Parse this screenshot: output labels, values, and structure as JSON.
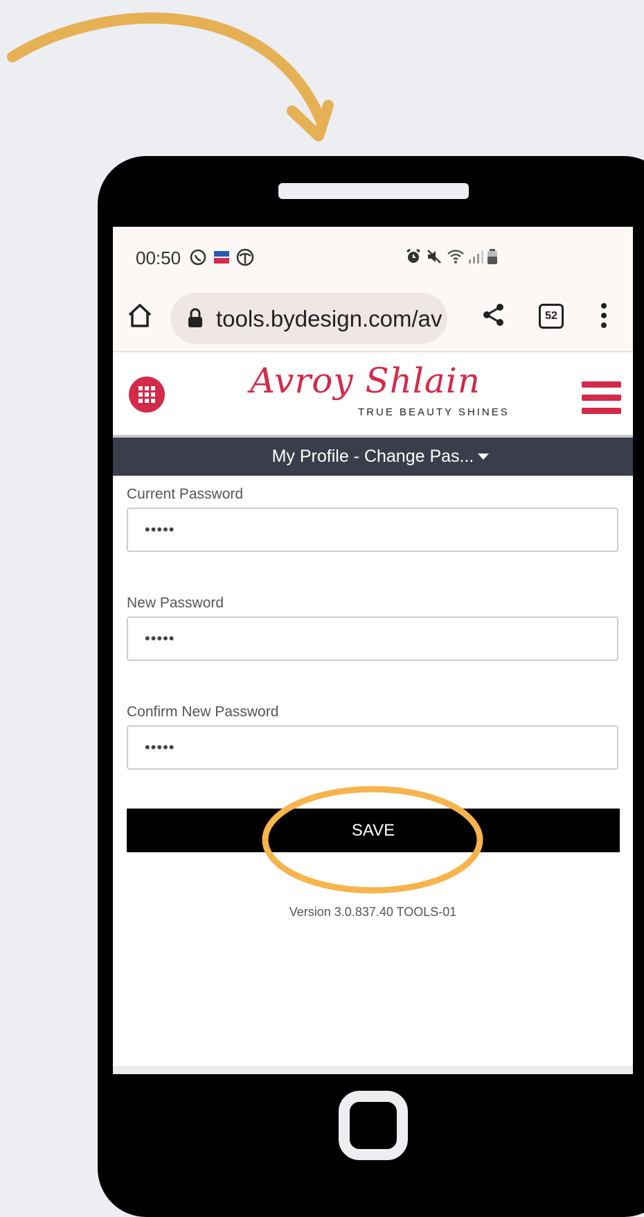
{
  "status_bar": {
    "time": "00:50",
    "left_icons": [
      "whatsapp-icon",
      "app-notification-icon",
      "app-notification-icon"
    ],
    "right_icons": [
      "alarm-icon",
      "mute-icon",
      "wifi-icon",
      "signal-icon",
      "battery-icon"
    ]
  },
  "browser": {
    "url": "tools.bydesign.com/av",
    "tabs_count": "52"
  },
  "site": {
    "logo": "Avroy Shlain",
    "tagline": "TRUE BEAUTY SHINES",
    "brand_color": "#d42a4a"
  },
  "subnav": {
    "title": "My Profile - Change Pas..."
  },
  "form": {
    "current_password_label": "Current Password",
    "current_password_value": "•••••",
    "new_password_label": "New Password",
    "new_password_value": "•••••",
    "confirm_password_label": "Confirm New Password",
    "confirm_password_value": "•••••",
    "save_label": "SAVE"
  },
  "footer": {
    "version": "Version 3.0.837.40 TOOLS-01"
  },
  "annotation": {
    "color": "#f7b44c"
  }
}
